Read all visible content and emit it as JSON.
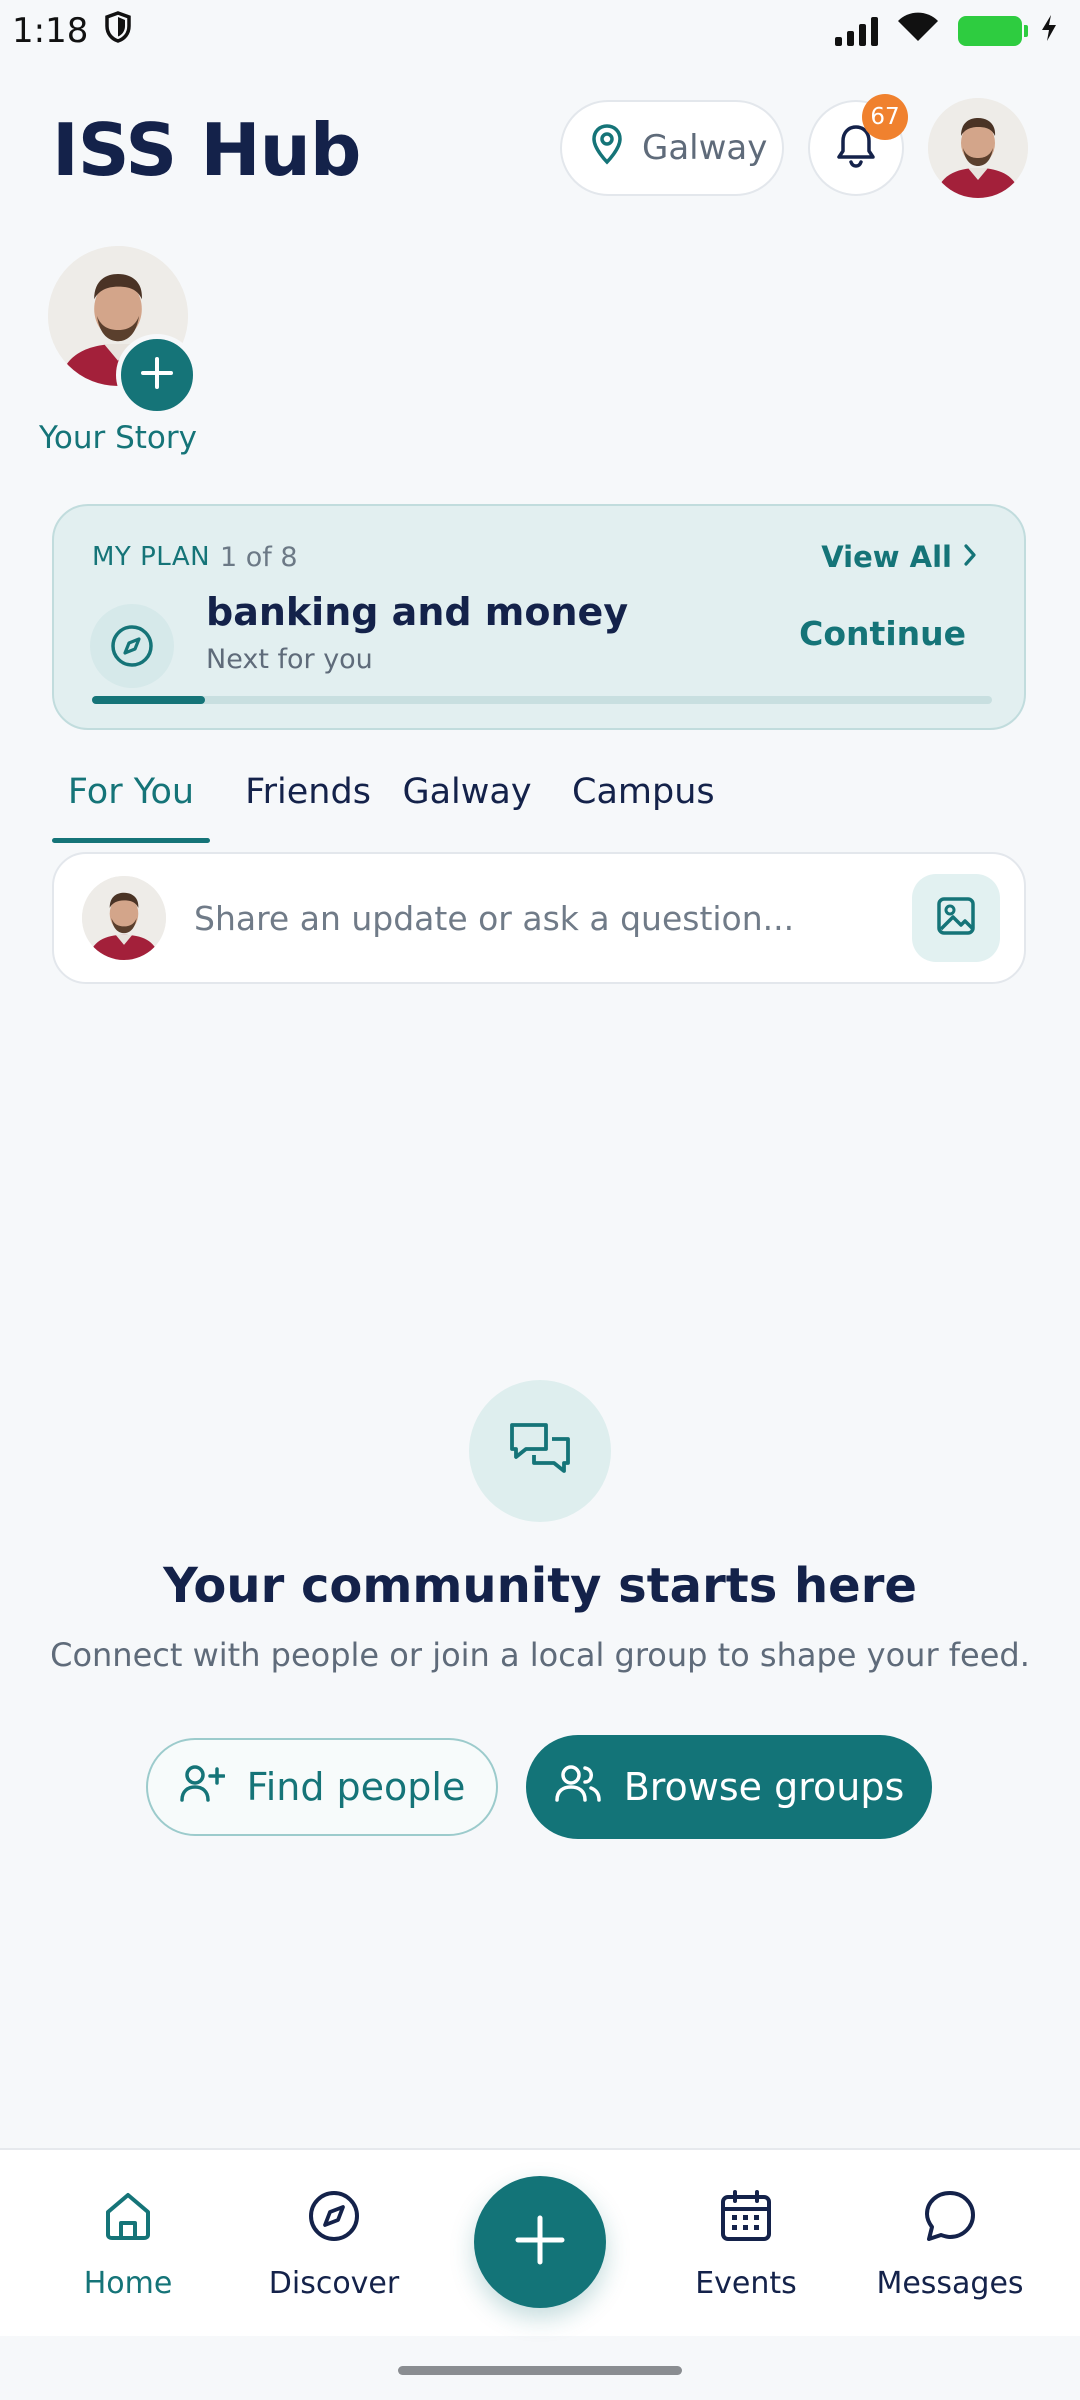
{
  "status_bar": {
    "time": "1:18"
  },
  "header": {
    "app_title": "ISS Hub",
    "location": "Galway",
    "notification_count": "67"
  },
  "story": {
    "label": "Your Story"
  },
  "plan": {
    "tag": "MY PLAN",
    "step": "1 of 8",
    "view_all": "View All",
    "title": "banking and money",
    "subtitle": "Next for you",
    "continue": "Continue",
    "progress": 0.125
  },
  "tabs": [
    {
      "label": "For You",
      "active": true
    },
    {
      "label": "Friends",
      "active": false
    },
    {
      "label": "Galway",
      "active": false
    },
    {
      "label": "Campus",
      "active": false
    }
  ],
  "composer": {
    "placeholder": "Share an update or ask a question..."
  },
  "empty_state": {
    "title": "Your community starts here",
    "text": "Connect with people or join a local group to shape your feed.",
    "find_people": "Find people",
    "browse_groups": "Browse groups"
  },
  "bottom_nav": {
    "home": "Home",
    "discover": "Discover",
    "events": "Events",
    "messages": "Messages"
  },
  "colors": {
    "accent": "#157478",
    "badge": "#f0812e",
    "title": "#14224a"
  }
}
